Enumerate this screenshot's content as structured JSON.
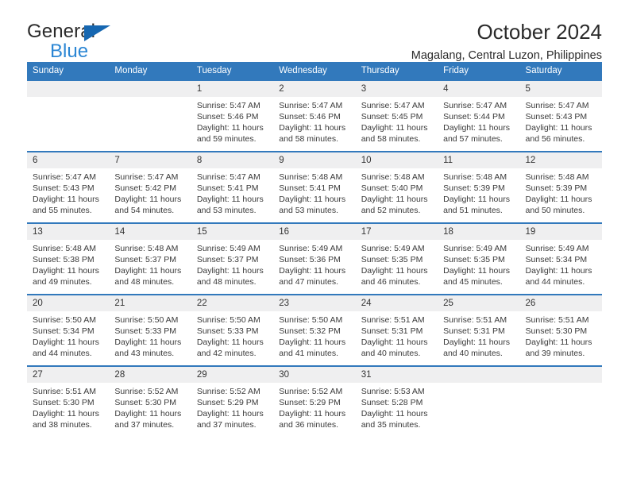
{
  "brand": {
    "name_part1": "General",
    "name_part2": "Blue",
    "triangle_color": "#1667b1",
    "blue_color": "#2b86d4"
  },
  "header": {
    "title": "October 2024",
    "subtitle": "Magalang, Central Luzon, Philippines"
  },
  "theme": {
    "header_bar_color": "#3279bc",
    "daynum_band_color": "#efeff0",
    "separator_color": "#3279bc"
  },
  "calendar": {
    "weekday_headers": [
      "Sunday",
      "Monday",
      "Tuesday",
      "Wednesday",
      "Thursday",
      "Friday",
      "Saturday"
    ],
    "weeks": [
      [
        {
          "day": ""
        },
        {
          "day": ""
        },
        {
          "day": "1",
          "sunrise": "Sunrise: 5:47 AM",
          "sunset": "Sunset: 5:46 PM",
          "daylight": "Daylight: 11 hours and 59 minutes."
        },
        {
          "day": "2",
          "sunrise": "Sunrise: 5:47 AM",
          "sunset": "Sunset: 5:46 PM",
          "daylight": "Daylight: 11 hours and 58 minutes."
        },
        {
          "day": "3",
          "sunrise": "Sunrise: 5:47 AM",
          "sunset": "Sunset: 5:45 PM",
          "daylight": "Daylight: 11 hours and 58 minutes."
        },
        {
          "day": "4",
          "sunrise": "Sunrise: 5:47 AM",
          "sunset": "Sunset: 5:44 PM",
          "daylight": "Daylight: 11 hours and 57 minutes."
        },
        {
          "day": "5",
          "sunrise": "Sunrise: 5:47 AM",
          "sunset": "Sunset: 5:43 PM",
          "daylight": "Daylight: 11 hours and 56 minutes."
        }
      ],
      [
        {
          "day": "6",
          "sunrise": "Sunrise: 5:47 AM",
          "sunset": "Sunset: 5:43 PM",
          "daylight": "Daylight: 11 hours and 55 minutes."
        },
        {
          "day": "7",
          "sunrise": "Sunrise: 5:47 AM",
          "sunset": "Sunset: 5:42 PM",
          "daylight": "Daylight: 11 hours and 54 minutes."
        },
        {
          "day": "8",
          "sunrise": "Sunrise: 5:47 AM",
          "sunset": "Sunset: 5:41 PM",
          "daylight": "Daylight: 11 hours and 53 minutes."
        },
        {
          "day": "9",
          "sunrise": "Sunrise: 5:48 AM",
          "sunset": "Sunset: 5:41 PM",
          "daylight": "Daylight: 11 hours and 53 minutes."
        },
        {
          "day": "10",
          "sunrise": "Sunrise: 5:48 AM",
          "sunset": "Sunset: 5:40 PM",
          "daylight": "Daylight: 11 hours and 52 minutes."
        },
        {
          "day": "11",
          "sunrise": "Sunrise: 5:48 AM",
          "sunset": "Sunset: 5:39 PM",
          "daylight": "Daylight: 11 hours and 51 minutes."
        },
        {
          "day": "12",
          "sunrise": "Sunrise: 5:48 AM",
          "sunset": "Sunset: 5:39 PM",
          "daylight": "Daylight: 11 hours and 50 minutes."
        }
      ],
      [
        {
          "day": "13",
          "sunrise": "Sunrise: 5:48 AM",
          "sunset": "Sunset: 5:38 PM",
          "daylight": "Daylight: 11 hours and 49 minutes."
        },
        {
          "day": "14",
          "sunrise": "Sunrise: 5:48 AM",
          "sunset": "Sunset: 5:37 PM",
          "daylight": "Daylight: 11 hours and 48 minutes."
        },
        {
          "day": "15",
          "sunrise": "Sunrise: 5:49 AM",
          "sunset": "Sunset: 5:37 PM",
          "daylight": "Daylight: 11 hours and 48 minutes."
        },
        {
          "day": "16",
          "sunrise": "Sunrise: 5:49 AM",
          "sunset": "Sunset: 5:36 PM",
          "daylight": "Daylight: 11 hours and 47 minutes."
        },
        {
          "day": "17",
          "sunrise": "Sunrise: 5:49 AM",
          "sunset": "Sunset: 5:35 PM",
          "daylight": "Daylight: 11 hours and 46 minutes."
        },
        {
          "day": "18",
          "sunrise": "Sunrise: 5:49 AM",
          "sunset": "Sunset: 5:35 PM",
          "daylight": "Daylight: 11 hours and 45 minutes."
        },
        {
          "day": "19",
          "sunrise": "Sunrise: 5:49 AM",
          "sunset": "Sunset: 5:34 PM",
          "daylight": "Daylight: 11 hours and 44 minutes."
        }
      ],
      [
        {
          "day": "20",
          "sunrise": "Sunrise: 5:50 AM",
          "sunset": "Sunset: 5:34 PM",
          "daylight": "Daylight: 11 hours and 44 minutes."
        },
        {
          "day": "21",
          "sunrise": "Sunrise: 5:50 AM",
          "sunset": "Sunset: 5:33 PM",
          "daylight": "Daylight: 11 hours and 43 minutes."
        },
        {
          "day": "22",
          "sunrise": "Sunrise: 5:50 AM",
          "sunset": "Sunset: 5:33 PM",
          "daylight": "Daylight: 11 hours and 42 minutes."
        },
        {
          "day": "23",
          "sunrise": "Sunrise: 5:50 AM",
          "sunset": "Sunset: 5:32 PM",
          "daylight": "Daylight: 11 hours and 41 minutes."
        },
        {
          "day": "24",
          "sunrise": "Sunrise: 5:51 AM",
          "sunset": "Sunset: 5:31 PM",
          "daylight": "Daylight: 11 hours and 40 minutes."
        },
        {
          "day": "25",
          "sunrise": "Sunrise: 5:51 AM",
          "sunset": "Sunset: 5:31 PM",
          "daylight": "Daylight: 11 hours and 40 minutes."
        },
        {
          "day": "26",
          "sunrise": "Sunrise: 5:51 AM",
          "sunset": "Sunset: 5:30 PM",
          "daylight": "Daylight: 11 hours and 39 minutes."
        }
      ],
      [
        {
          "day": "27",
          "sunrise": "Sunrise: 5:51 AM",
          "sunset": "Sunset: 5:30 PM",
          "daylight": "Daylight: 11 hours and 38 minutes."
        },
        {
          "day": "28",
          "sunrise": "Sunrise: 5:52 AM",
          "sunset": "Sunset: 5:30 PM",
          "daylight": "Daylight: 11 hours and 37 minutes."
        },
        {
          "day": "29",
          "sunrise": "Sunrise: 5:52 AM",
          "sunset": "Sunset: 5:29 PM",
          "daylight": "Daylight: 11 hours and 37 minutes."
        },
        {
          "day": "30",
          "sunrise": "Sunrise: 5:52 AM",
          "sunset": "Sunset: 5:29 PM",
          "daylight": "Daylight: 11 hours and 36 minutes."
        },
        {
          "day": "31",
          "sunrise": "Sunrise: 5:53 AM",
          "sunset": "Sunset: 5:28 PM",
          "daylight": "Daylight: 11 hours and 35 minutes."
        },
        {
          "day": ""
        },
        {
          "day": ""
        }
      ]
    ]
  }
}
